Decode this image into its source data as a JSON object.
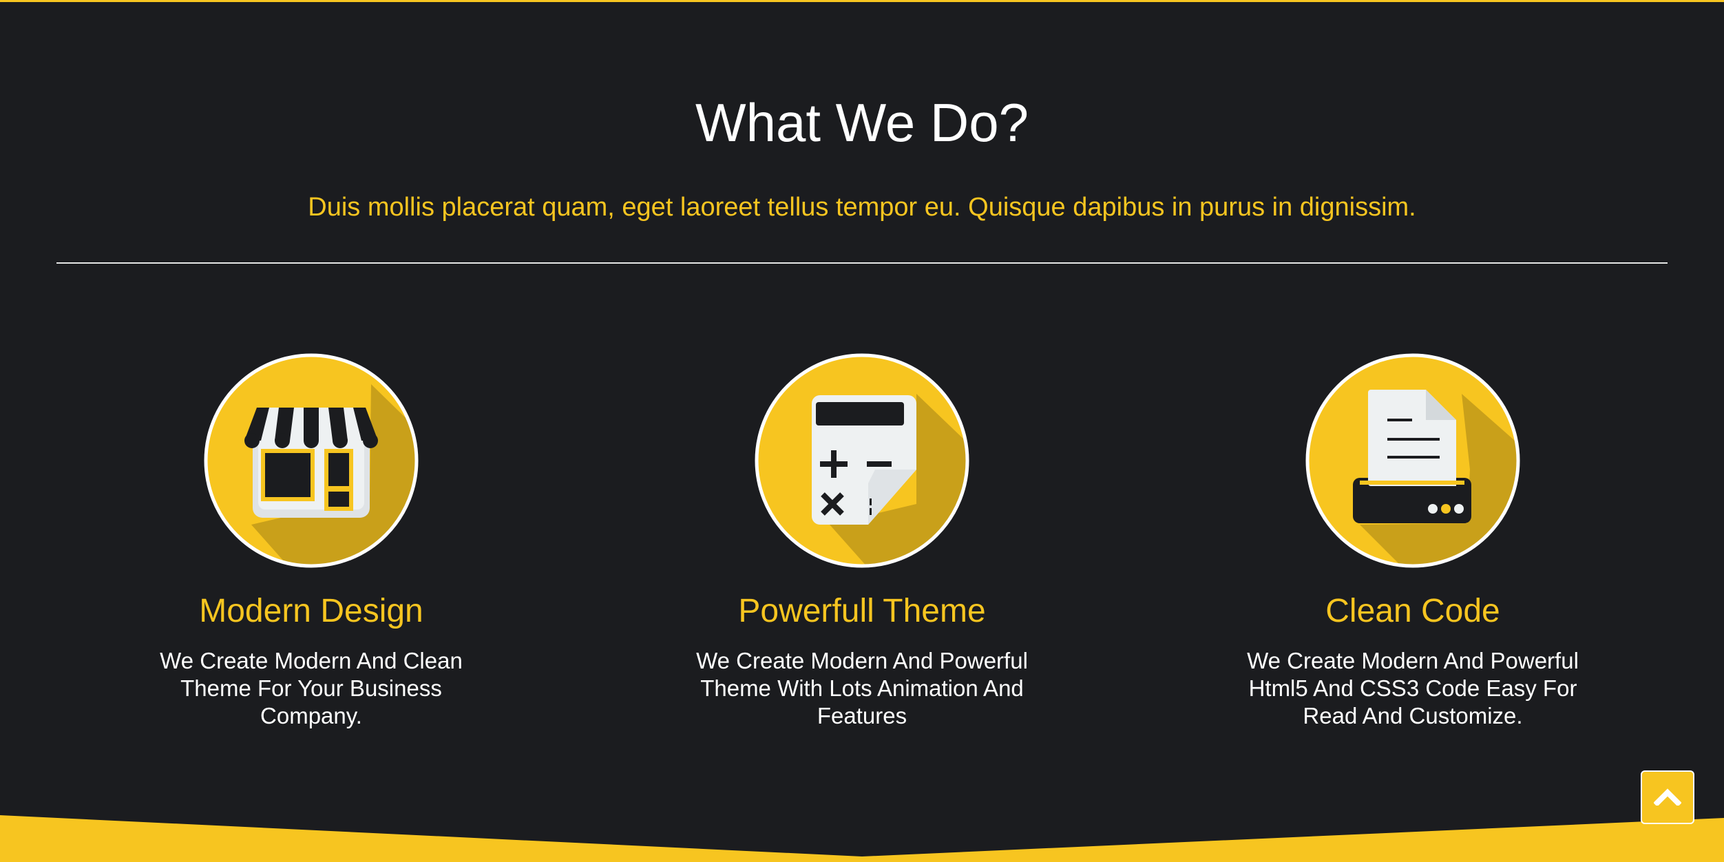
{
  "section": {
    "title": "What We Do?",
    "subtitle": "Duis mollis placerat quam, eget laoreet tellus tempor eu. Quisque dapibus in purus in dignissim."
  },
  "features": [
    {
      "icon": "storefront-icon",
      "title": "Modern Design",
      "description": "We Create Modern And Clean Theme For Your Business Company."
    },
    {
      "icon": "calculator-icon",
      "title": "Powerfull Theme",
      "description": "We Create Modern And Powerful Theme With Lots Animation And Features"
    },
    {
      "icon": "printer-icon",
      "title": "Clean Code",
      "description": "We Create Modern And Powerful Html5 And CSS3 Code Easy For Read And Customize."
    }
  ],
  "scroll_top": {
    "icon": "chevron-up-icon"
  },
  "colors": {
    "background": "#1b1c1f",
    "accent": "#f7c520",
    "text": "#ffffff"
  }
}
